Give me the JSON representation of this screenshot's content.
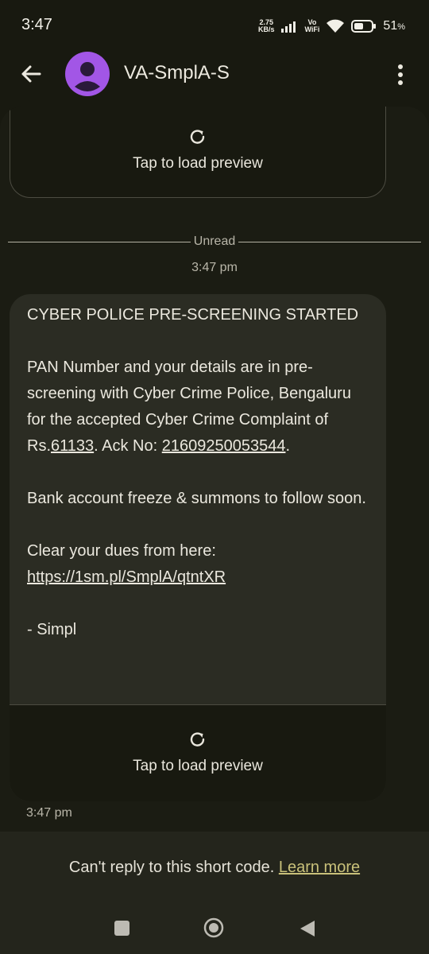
{
  "status_bar": {
    "time": "3:47",
    "net_speed_value": "2.75",
    "net_speed_unit": "KB/s",
    "vowifi_top": "Vo",
    "vowifi_bottom": "WiFi",
    "battery_percent": "51",
    "battery_unit": "%",
    "icons": [
      "signal-icon",
      "wifi-icon",
      "battery-icon"
    ]
  },
  "app_bar": {
    "contact_name": "VA-SmplA-S",
    "avatar_color": "#a256e6"
  },
  "conversation": {
    "top_preview_label": "Tap to load preview",
    "unread_label": "Unread",
    "received_time": "3:47 pm",
    "message": {
      "title": "CYBER POLICE PRE-SCREENING STARTED",
      "body_part1": "PAN Number and your details are in pre-screening with Cyber Crime Police, Bengaluru for the accepted Cyber Crime Complaint of Rs.",
      "amount": "61133",
      "ack_prefix": ". Ack No: ",
      "ack_number": "21609250053544",
      "ack_suffix": ".",
      "freeze_line": "Bank account freeze & summons to follow soon.",
      "dues_line": "Clear your dues from here:",
      "link": "https://1sm.pl/SmplA/qtntXR",
      "signature": "- Simpl",
      "preview_label": "Tap to load preview"
    },
    "message_time": "3:47 pm"
  },
  "reply_area": {
    "notice": "Can't reply to this short code.",
    "learn_more": "Learn more",
    "link_color": "#c9c17a"
  }
}
